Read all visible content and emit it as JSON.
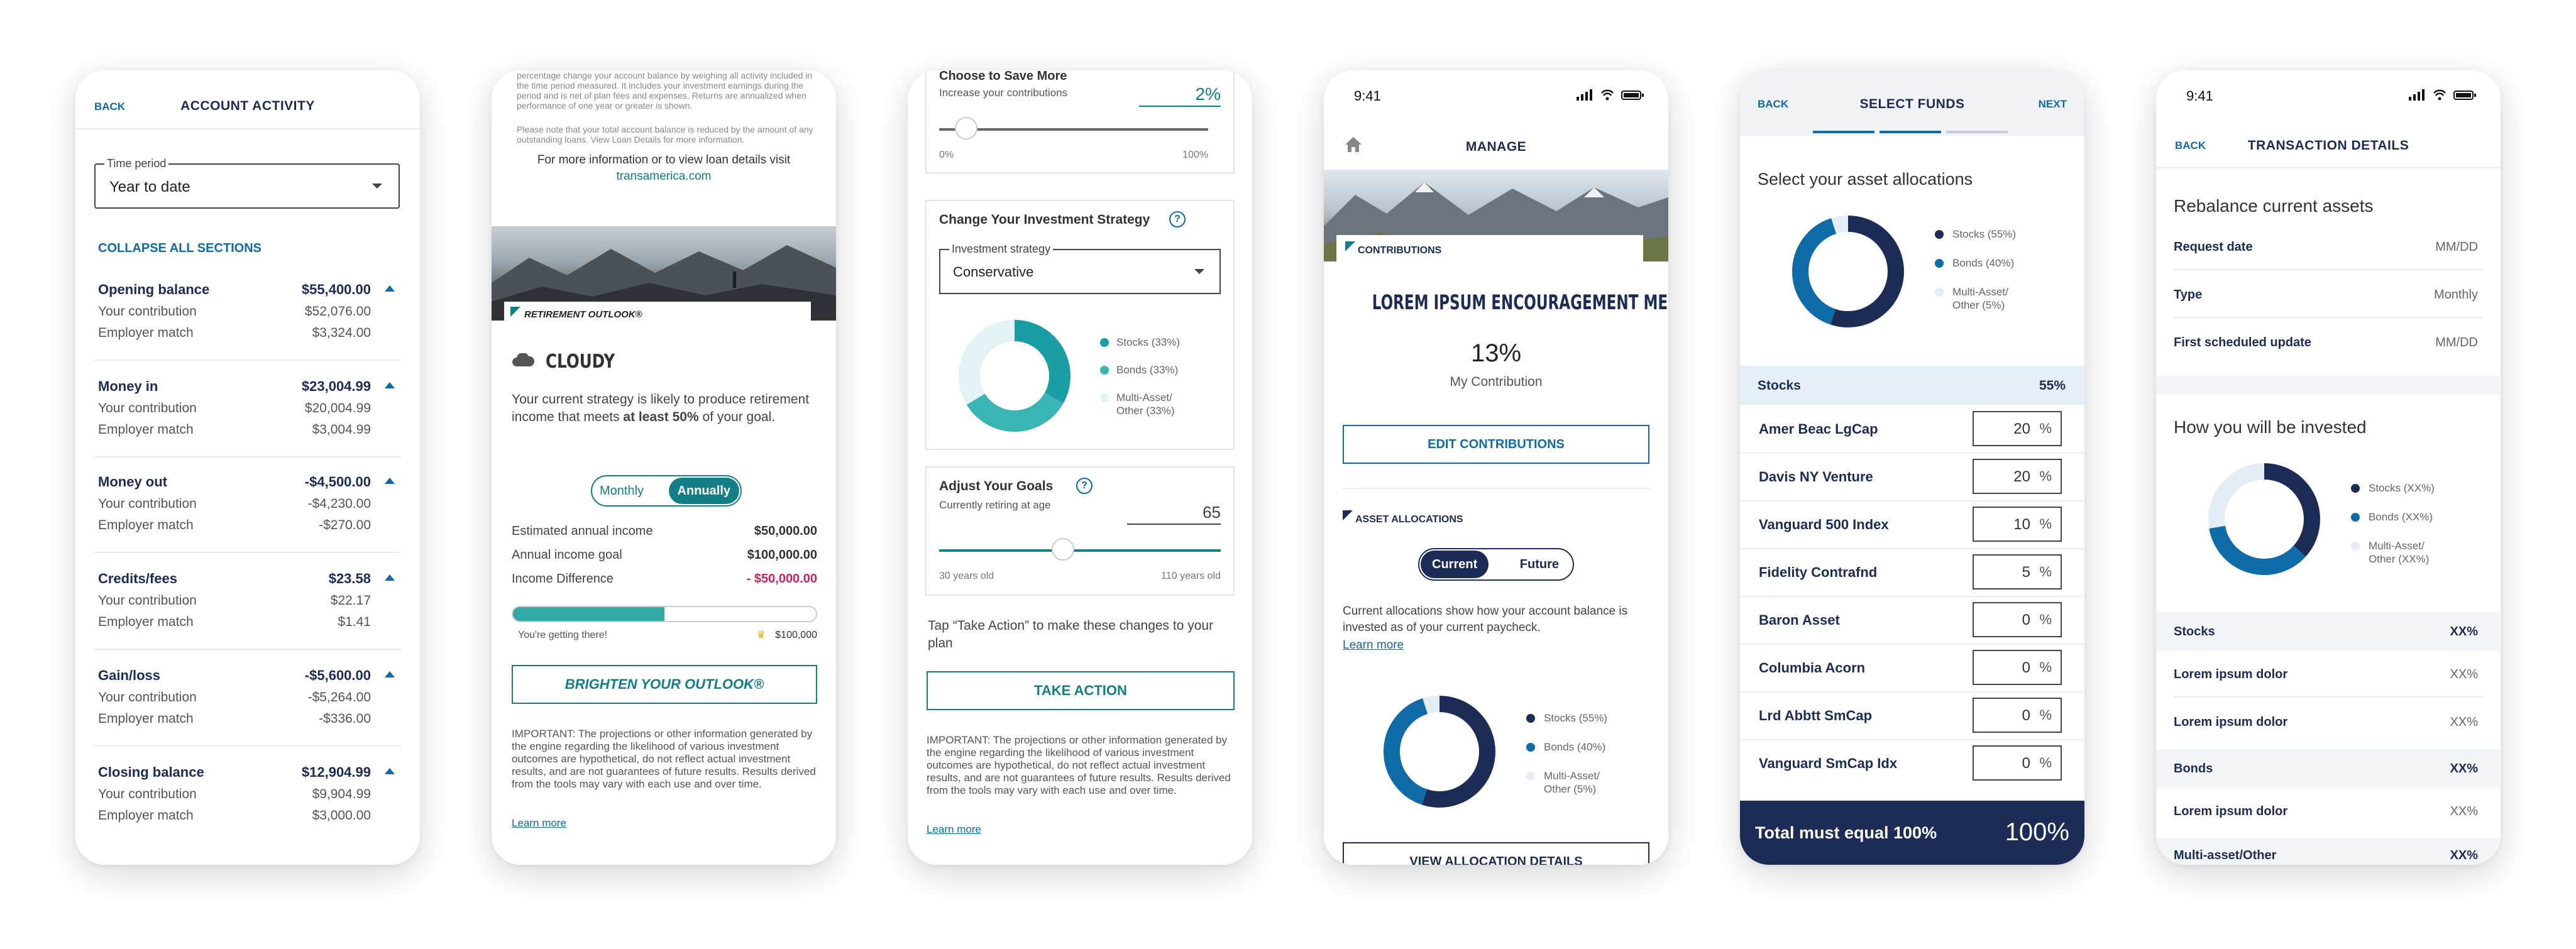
{
  "s1": {
    "back": "BACK",
    "title": "ACCOUNT ACTIVITY",
    "time_label": "Time period",
    "time_value": "Year to date",
    "collapse": "COLLAPSE ALL SECTIONS",
    "sections": [
      {
        "name": "Opening balance",
        "total": "$55,400.00",
        "contrib": "$52,076.00",
        "match": "$3,324.00"
      },
      {
        "name": "Money in",
        "total": "$23,004.99",
        "contrib": "$20,004.99",
        "match": "$3,004.99"
      },
      {
        "name": "Money out",
        "total": "-$4,500.00",
        "contrib": "-$4,230.00",
        "match": "-$270.00"
      },
      {
        "name": "Credits/fees",
        "total": "$23.58",
        "contrib": "$22.17",
        "match": "$1.41"
      },
      {
        "name": "Gain/loss",
        "total": "-$5,600.00",
        "contrib": "-$5,264.00",
        "match": "-$336.00"
      },
      {
        "name": "Closing balance",
        "total": "$12,904.99",
        "contrib": "$9,904.99",
        "match": "$3,000.00"
      }
    ],
    "contrib_label": "Your contribution",
    "match_label": "Employer match"
  },
  "s2": {
    "top_text": "percentage change your account balance by weighing all activity included in the time period measured. It includes your investment earnings during the period and is net of plan fees and expenses. Returns are annualized when performance of one year or greater is shown.",
    "loan_note": "Please note that your total account balance is reduced by the amount of any outstanding loans. View Loan Details for more information.",
    "more_info": "For more information or to view loan details visit",
    "link": "transamerica.com",
    "badge": "RETIREMENT OUTLOOK®",
    "outlook": "CLOUDY",
    "strategy_pre": "Your current strategy is likely to produce retirement income that meets ",
    "strategy_bold": "at least 50%",
    "strategy_post": " of your goal.",
    "toggle_a": "Monthly",
    "toggle_b": "Annually",
    "rows": [
      {
        "label": "Estimated annual income",
        "value": "$50,000.00"
      },
      {
        "label": "Annual income goal",
        "value": "$100,000.00"
      },
      {
        "label": "Income Difference",
        "value": "- $50,000.00"
      }
    ],
    "progress": 0.5,
    "progress_note": "You're getting there!",
    "progress_goal": "$100,000",
    "button": "BRIGHTEN YOUR OUTLOOK®",
    "important": "IMPORTANT: The projections or other information generated by the engine regarding the likelihood of various investment outcomes are hypothetical, do not reflect actual investment results, and are not guarantees of future results. Results derived from the tools may vary with each use and over time.",
    "learn": "Learn more"
  },
  "s3": {
    "save_title": "Choose to Save More",
    "save_sub": "Increase your contributions",
    "save_value": "2%",
    "slider1_min": "0%",
    "slider1_max": "100%",
    "slider1_pos": 0.1,
    "strategy_title": "Change Your Investment Strategy",
    "strategy_label": "Investment strategy",
    "strategy_value": "Conservative",
    "legend": [
      {
        "label": "Stocks (33%)",
        "color": "#1a9da3"
      },
      {
        "label": "Bonds (33%)",
        "color": "#3bb5b4"
      },
      {
        "label": "Multi-Asset/ Other (33%)",
        "color": "#e3f3f3"
      }
    ],
    "goals_title": "Adjust Your Goals",
    "goals_sub": "Currently retiring at age",
    "goals_value": "65",
    "slider2_min": "30 years old",
    "slider2_max": "110 years old",
    "slider2_pos": 0.44,
    "tap": "Tap “Take Action” to make these changes to your plan",
    "button": "TAKE ACTION",
    "important": "IMPORTANT: The projections or other information generated by the engine regarding the likelihood of various investment outcomes are hypothetical, do not reflect actual investment results, and are not guarantees of future results. Results derived from the tools may vary with each use and over time.",
    "learn": "Learn more"
  },
  "s4": {
    "time": "9:41",
    "title": "MANAGE",
    "contrib_badge": "CONTRIBUTIONS",
    "message": "LOREM IPSUM ENCOURAGEMENT MESSAGE",
    "percent": "13%",
    "my_contrib": "My Contribution",
    "edit": "EDIT CONTRIBUTIONS",
    "alloc_badge": "ASSET ALLOCATIONS",
    "toggle_a": "Current",
    "toggle_b": "Future",
    "alloc_text": "Current allocations show how your account balance is invested as of your current paycheck.",
    "learn": "Learn more",
    "legend": [
      {
        "label": "Stocks (55%)",
        "color": "#1c2c56"
      },
      {
        "label": "Bonds (40%)",
        "color": "#0f6aa8"
      },
      {
        "label": "Multi-Asset/ Other (5%)",
        "color": "#e4edf6"
      }
    ],
    "view": "VIEW ALLOCATION DETAILS"
  },
  "s5": {
    "back": "BACK",
    "title": "SELECT FUNDS",
    "next": "NEXT",
    "heading": "Select your asset allocations",
    "legend": [
      {
        "label": "Stocks (55%)",
        "color": "#1c2c56"
      },
      {
        "label": "Bonds (40%)",
        "color": "#0f6aa8"
      },
      {
        "label": "Multi-Asset/ Other (5%)",
        "color": "#e4edf6"
      }
    ],
    "group": "Stocks",
    "group_pct": "55%",
    "funds": [
      {
        "name": "Amer Beac LgCap",
        "value": "20"
      },
      {
        "name": "Davis NY Venture",
        "value": "20"
      },
      {
        "name": "Vanguard 500 Index",
        "value": "10"
      },
      {
        "name": "Fidelity Contrafnd",
        "value": "5"
      },
      {
        "name": "Baron Asset",
        "value": "0"
      },
      {
        "name": "Columbia Acorn",
        "value": "0"
      },
      {
        "name": "Lrd Abbtt SmCap",
        "value": "0"
      },
      {
        "name": "Vanguard SmCap Idx",
        "value": "0"
      }
    ],
    "pct_sign": "%",
    "total_label": "Total must equal 100%",
    "total_value": "100%"
  },
  "s6": {
    "time": "9:41",
    "back": "BACK",
    "title": "TRANSACTION DETAILS",
    "heading": "Rebalance current assets",
    "details": [
      {
        "label": "Request date",
        "value": "MM/DD"
      },
      {
        "label": "Type",
        "value": "Monthly"
      },
      {
        "label": "First scheduled update",
        "value": "MM/DD"
      }
    ],
    "invested": "How you will be invested",
    "legend": [
      {
        "label": "Stocks (XX%)",
        "color": "#1c2c56"
      },
      {
        "label": "Bonds (XX%)",
        "color": "#0f6aa8"
      },
      {
        "label": "Multi-Asset/ Other (XX%)",
        "color": "#e4edf6"
      }
    ],
    "groups": [
      {
        "name": "Stocks",
        "value": "XX%"
      },
      {
        "name": "Bonds",
        "value": "XX%"
      },
      {
        "name": "Multi-asset/Other",
        "value": "XX%"
      }
    ],
    "item": "Lorem ipsum dolor",
    "item_value": "XX%"
  }
}
